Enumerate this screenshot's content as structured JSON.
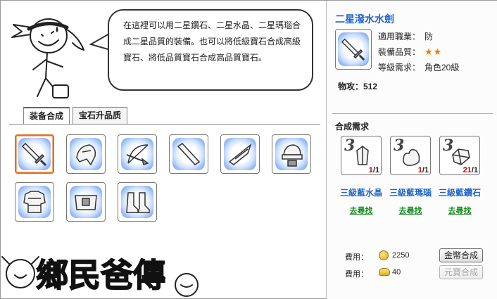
{
  "intro_text": "在這裡可以用二星鑽石、二星水晶、二星瑪瑙合成二星品質的裝備。也可以將低級寶石合成高級寶石、將低品質寶石合成高品質寶石。",
  "tabs": [
    {
      "label": "装备合成",
      "active": true
    },
    {
      "label": "宝石升品质",
      "active": false
    }
  ],
  "slots": [
    {
      "icon": "sword-icon",
      "selected": true
    },
    {
      "icon": "helmet-icon",
      "selected": false
    },
    {
      "icon": "bow-icon",
      "selected": false
    },
    {
      "icon": "staff-icon",
      "selected": false
    },
    {
      "icon": "fan-icon",
      "selected": false
    },
    {
      "icon": "hat-icon",
      "selected": false
    },
    {
      "icon": "armor-icon",
      "selected": false
    },
    {
      "icon": "belt-icon",
      "selected": false
    },
    {
      "icon": "boots-icon",
      "selected": false
    }
  ],
  "logo_text": "鄉民爸傳",
  "item": {
    "name": "二星潑水水劍",
    "icon": "sword-icon",
    "attributes": [
      {
        "key": "適用職業：",
        "value": "防"
      },
      {
        "key": "裝備品質：",
        "value": "★★"
      },
      {
        "key": "等級需求：",
        "value": "角色20級"
      }
    ],
    "attack": "物攻：512"
  },
  "requirements": {
    "title": "合成需求",
    "items": [
      {
        "level": "3",
        "icon": "crystal-icon",
        "have": "1",
        "need": "/1",
        "name": "三級藍水晶",
        "link": "去尋找"
      },
      {
        "level": "3",
        "icon": "agate-icon",
        "have": "1",
        "need": "/1",
        "name": "三級藍瑪瑙",
        "link": "去尋找"
      },
      {
        "level": "3",
        "icon": "diamond-icon",
        "have": "21",
        "need": "/1",
        "name": "三級藍鑽石",
        "link": "去尋找"
      }
    ]
  },
  "costs": [
    {
      "label": "費用：",
      "icon": "gold-coin-icon",
      "value": "2250",
      "button": "金幣合成",
      "enabled": true
    },
    {
      "label": "費用：",
      "icon": "ingot-icon",
      "value": "40",
      "button": "元寶合成",
      "enabled": false
    }
  ],
  "colors": {
    "accent": "#1f64c8",
    "link": "#138a1e",
    "stars": "#f07a00",
    "count_have": "#c00000",
    "selected_border": "#e07020"
  }
}
